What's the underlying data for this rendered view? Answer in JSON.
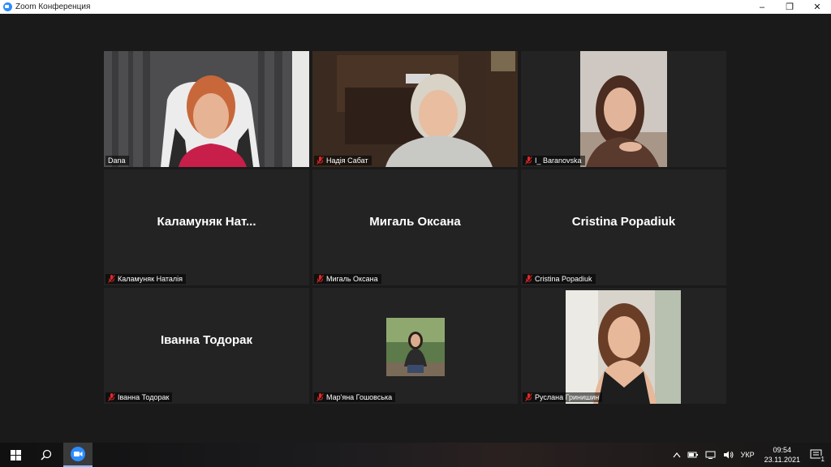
{
  "window": {
    "title": "Zoom Конференция",
    "minimize": "–",
    "restore": "❐",
    "close": "✕"
  },
  "participants": [
    {
      "label": "Dana",
      "muted": false,
      "active": true
    },
    {
      "label": "Надія Сабат",
      "muted": true
    },
    {
      "label": "I_ Baranovska",
      "muted": true
    },
    {
      "label": "Каламуняк Наталія",
      "display": "Каламуняк  Нат...",
      "muted": true
    },
    {
      "label": "Мигаль Оксана",
      "display": "Мигаль Оксана",
      "muted": true
    },
    {
      "label": "Cristina Popadiuk",
      "display": "Cristina Popadiuk",
      "muted": true
    },
    {
      "label": "Іванна Тодорак",
      "display": "Іванна Тодорак",
      "muted": true
    },
    {
      "label": "Мар'яна Гошовська",
      "muted": true
    },
    {
      "label": "Руслана Гринишин",
      "muted": true
    }
  ],
  "taskbar": {
    "language": "УКР",
    "time": "09:54",
    "date": "23.11.2021",
    "notifications": "1"
  },
  "colors": {
    "active_speaker": "#c6e36a",
    "muted_red": "#e02828",
    "zoom_blue": "#2d8cff"
  }
}
